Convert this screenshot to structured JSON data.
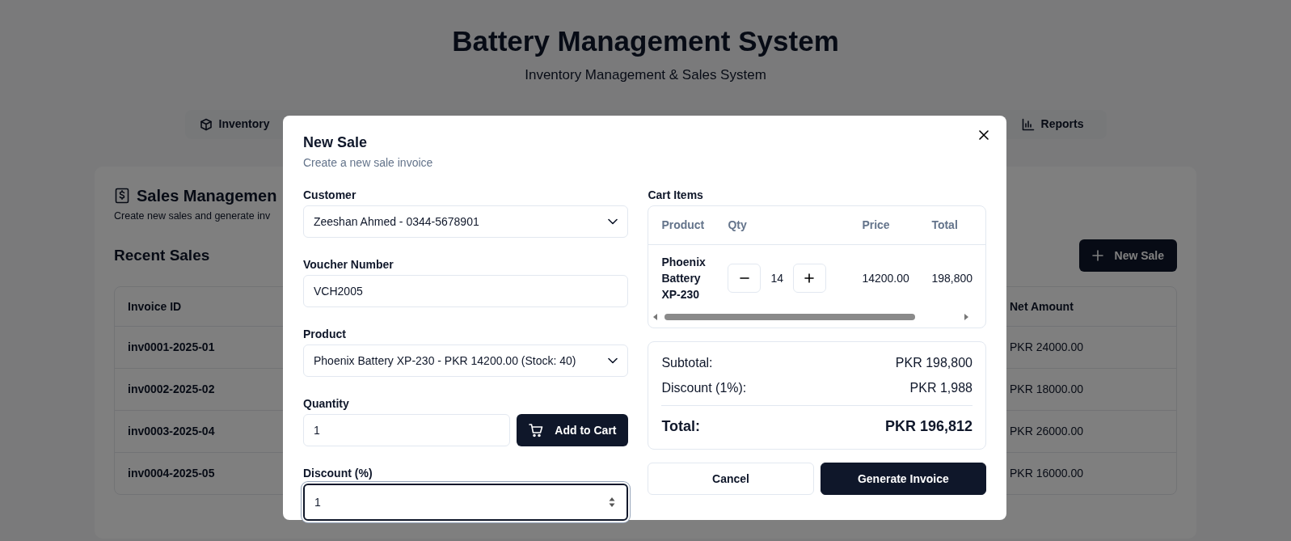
{
  "page": {
    "title": "Battery Management System",
    "subtitle": "Inventory Management & Sales System"
  },
  "nav_tabs": [
    {
      "label": "Inventory",
      "selected": false
    },
    {
      "label": "Reports",
      "selected": false
    }
  ],
  "sales_card": {
    "title": "Sales Managemen",
    "subtitle": "Create new sales and generate inv",
    "section_title": "Recent Sales",
    "new_sale_button": "New Sale",
    "table": {
      "columns": [
        "Invoice ID",
        "Net Amount"
      ],
      "rows": [
        [
          "inv0001-2025-01",
          "PKR 24000.00"
        ],
        [
          "inv0002-2025-02",
          "PKR 18000.00"
        ],
        [
          "inv0003-2025-04",
          "PKR 26000.00"
        ],
        [
          "inv0004-2025-05",
          "PKR 16000.00"
        ]
      ]
    }
  },
  "modal": {
    "title": "New Sale",
    "subtitle": "Create a new sale invoice",
    "fields": [
      {
        "kind": "select",
        "label": "Customer",
        "value": "Zeeshan Ahmed - 0344-5678901",
        "focused": false
      },
      {
        "kind": "text",
        "label": "Voucher Number",
        "value": "VCH2005",
        "focused": false
      },
      {
        "kind": "select",
        "label": "Product",
        "value": "Phoenix Battery XP-230 - PKR 14200.00 (Stock: 40)",
        "focused": false
      },
      {
        "kind": "quantity",
        "label": "Quantity",
        "value": "1",
        "button": "Add to Cart",
        "focused": false
      },
      {
        "kind": "number",
        "label": "Discount (%)",
        "value": "1",
        "focused": true
      }
    ],
    "cart": {
      "label": "Cart Items",
      "columns": [
        "Product",
        "Qty",
        "Price",
        "Total"
      ],
      "rows": [
        {
          "product": "Phoenix Battery XP-230",
          "qty": "14",
          "price": "14200.00",
          "total": "198,800"
        }
      ]
    },
    "summary": {
      "rows": [
        {
          "label": "Subtotal:",
          "value": "PKR 198,800"
        },
        {
          "label": "Discount (1%):",
          "value": "PKR 1,988"
        }
      ],
      "total": {
        "label": "Total:",
        "value": "PKR 196,812"
      }
    },
    "actions": [
      {
        "label": "Cancel",
        "kind": "secondary"
      },
      {
        "label": "Generate Invoice",
        "kind": "primary"
      }
    ]
  }
}
